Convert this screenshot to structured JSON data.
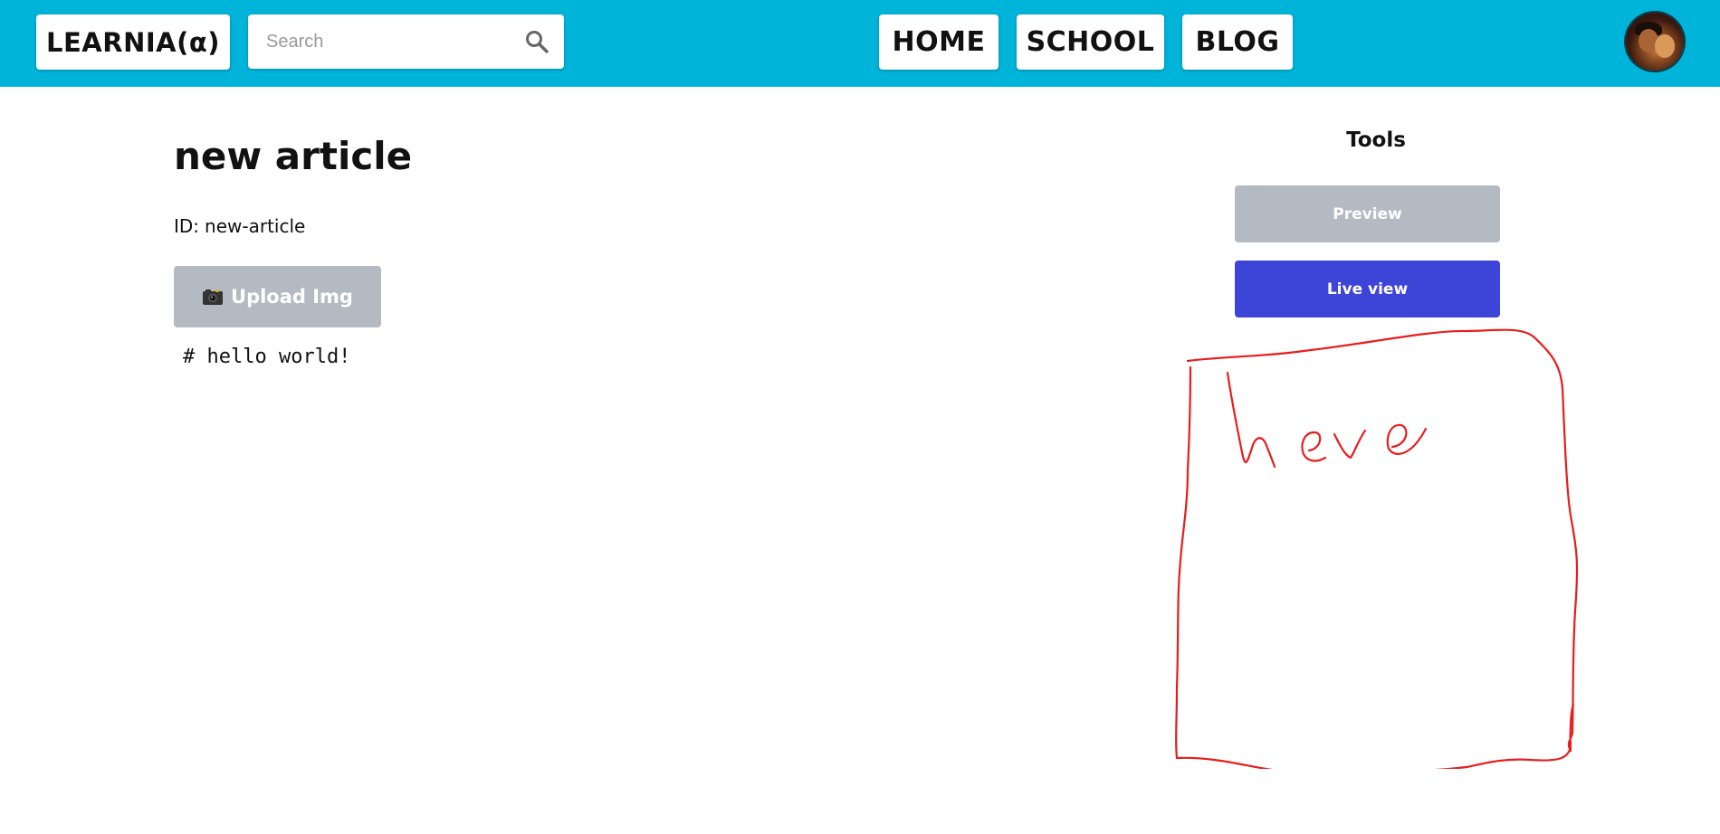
{
  "header": {
    "brand": "LEARNIA(α)",
    "search_placeholder": "Search",
    "search_icon": "search-icon",
    "nav": [
      {
        "label": "HOME"
      },
      {
        "label": "SCHOOL"
      },
      {
        "label": "BLOG"
      }
    ],
    "avatar_icon": "user-avatar",
    "bar_color": "#00b3d9"
  },
  "article": {
    "title": "new article",
    "id_label": "ID:",
    "id_value": "new-article",
    "upload_label": "Upload Img",
    "upload_icon": "camera-icon",
    "editor_content": "# hello world!"
  },
  "tools": {
    "title": "Tools",
    "preview_label": "Preview",
    "live_view_label": "Live view",
    "live_view_color": "#3d44d8",
    "disabled_color": "#b3bac2"
  },
  "annotation": {
    "text": "here",
    "color": "#e81c1c"
  }
}
